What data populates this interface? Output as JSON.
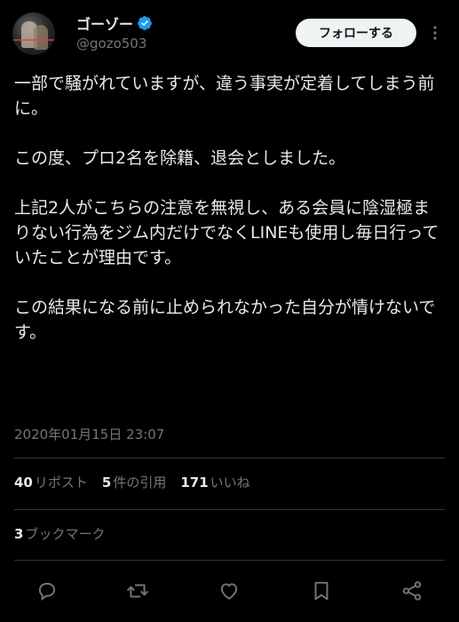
{
  "header": {
    "display_name": "ゴーゾー",
    "handle": "@gozo503",
    "follow_label": "フォローする"
  },
  "tweet": {
    "text": "一部で騒がれていますが、違う事実が定着してしまう前に。\n\nこの度、プロ2名を除籍、退会としました。\n\n上記2人がこちらの注意を無視し、ある会員に陰湿極まりない行為をジム内だけでなくLINEも使用し毎日行っていたことが理由です。\n\nこの結果になる前に止められなかった自分が情けないです。",
    "timestamp": "2020年01月15日 23:07"
  },
  "stats": {
    "reposts": {
      "count": "40",
      "label": "リポスト"
    },
    "quotes": {
      "count": "5",
      "label": "件の引用"
    },
    "likes": {
      "count": "171",
      "label": "いいね"
    },
    "bookmarks": {
      "count": "3",
      "label": "ブックマーク"
    }
  },
  "icons": {
    "verified": "verified-badge-icon",
    "more": "more-options-icon",
    "reply": "reply-icon",
    "repost": "repost-icon",
    "like": "like-icon",
    "bookmark": "bookmark-icon",
    "share": "share-icon"
  },
  "colors": {
    "background": "#000000",
    "text": "#e7e9ea",
    "secondary": "#71767b",
    "verified": "#1d9bf0",
    "follow_button_bg": "#eff3f4"
  }
}
